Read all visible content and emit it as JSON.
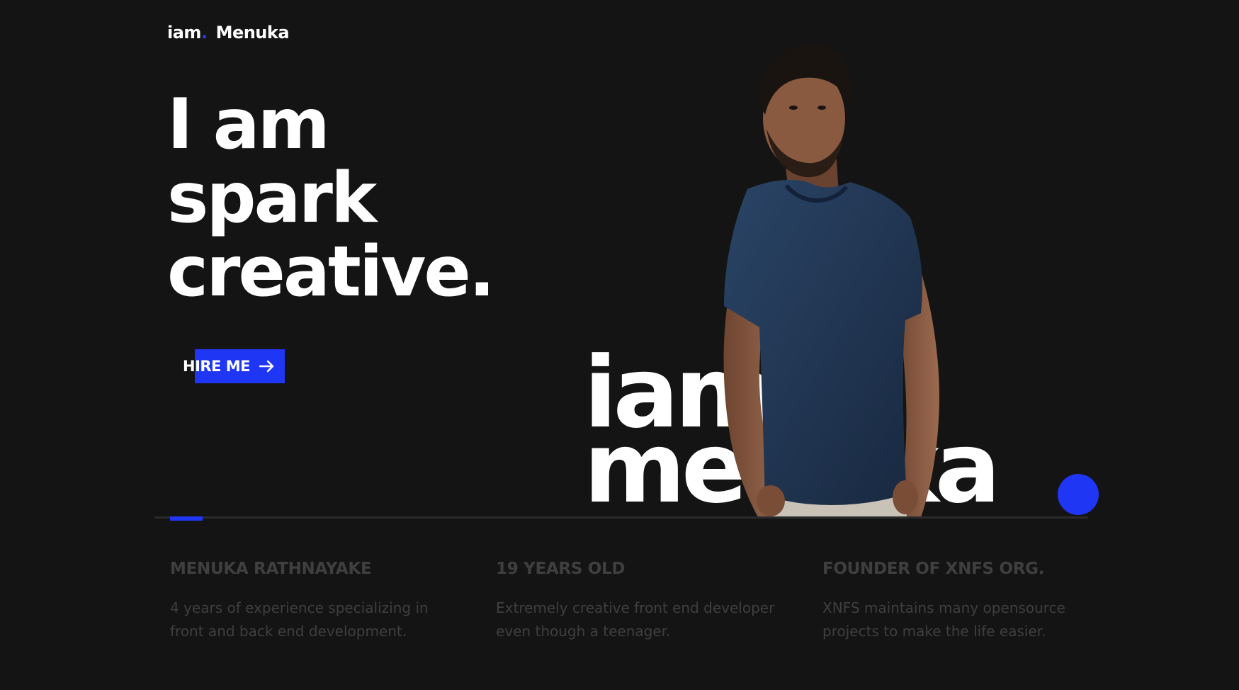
{
  "header": {
    "logo_prefix": "iam",
    "logo_dot": ".",
    "logo_name": "Menuka"
  },
  "hero": {
    "line1": "I am",
    "line2": "spark",
    "line3": "creative.",
    "hire_label": "HIRE ME",
    "hire_icon": "arrow-right-icon",
    "big_line1": "iam",
    "big_line2": "menuka"
  },
  "info": [
    {
      "title": "MENUKA RATHNAYAKE",
      "text": "4 years of experience specializing in front and back end development."
    },
    {
      "title": "19 YEARS OLD",
      "text": "Extremely creative front end developer even though a teenager."
    },
    {
      "title": "FOUNDER OF XNFS ORG.",
      "text": "XNFS maintains many opensource projects to make the life easier."
    }
  ],
  "colors": {
    "background": "#141414",
    "accent": "#1f36f5",
    "text": "#ffffff",
    "muted": "#3f3f3f",
    "shirt": "#1c3350"
  }
}
